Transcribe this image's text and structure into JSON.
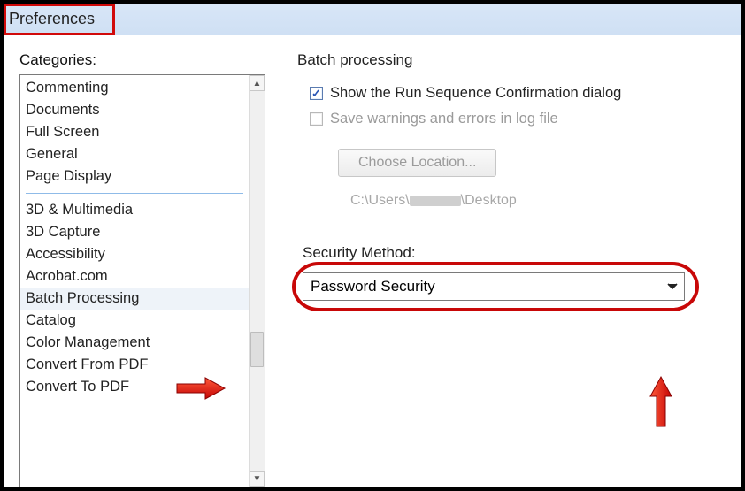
{
  "window": {
    "title": "Preferences"
  },
  "sidebar": {
    "label": "Categories:",
    "items_top": [
      "Commenting",
      "Documents",
      "Full Screen",
      "General",
      "Page Display"
    ],
    "items_bottom": [
      "3D & Multimedia",
      "3D Capture",
      "Accessibility",
      "Acrobat.com",
      "Batch Processing",
      "Catalog",
      "Color Management",
      "Convert From PDF",
      "Convert To PDF"
    ],
    "selected": "Batch Processing"
  },
  "panel": {
    "heading": "Batch processing",
    "check1_label": "Show the Run Sequence Confirmation dialog",
    "check1_checked": true,
    "check2_label": "Save warnings and errors in log file",
    "check2_checked": false,
    "choose_button": "Choose Location...",
    "path_prefix": "C:\\Users\\",
    "path_suffix": "\\Desktop",
    "security_label": "Security Method:",
    "security_value": "Password Security"
  }
}
